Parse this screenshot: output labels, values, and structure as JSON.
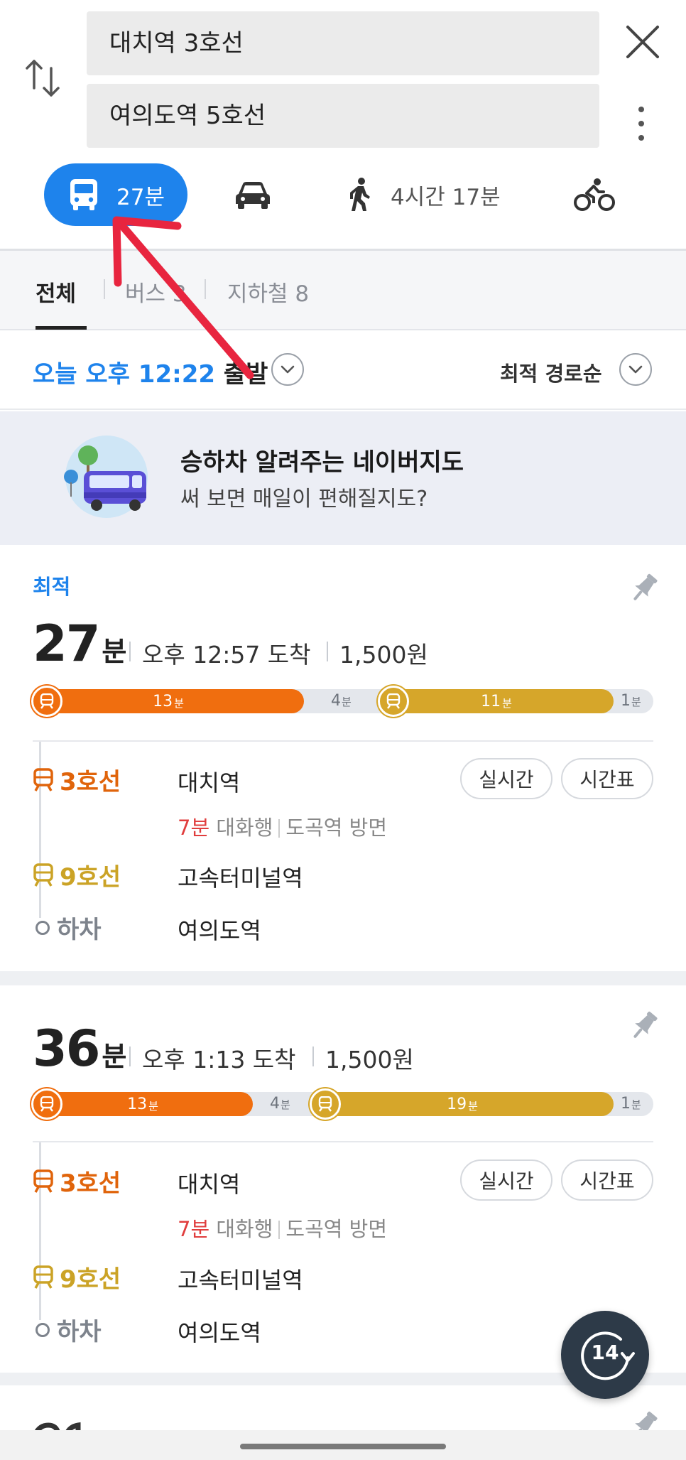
{
  "search": {
    "origin": "대치역 3호선",
    "destination": "여의도역 5호선"
  },
  "modes": {
    "transit": "27분",
    "car": "",
    "walk": "4시간 17분",
    "bike": ""
  },
  "filters": {
    "all": "전체",
    "bus": "버스 3",
    "subway": "지하철 8"
  },
  "departure": {
    "time": "오늘 오후 12:22",
    "suffix": " 출발",
    "sort": "최적 경로순"
  },
  "banner": {
    "title": "승하차 알려주는 네이버지도",
    "subtitle": "써 보면 매일이 편해질지도?"
  },
  "routes": [
    {
      "badge": "최적",
      "duration": "27",
      "duration_unit": "분",
      "arrival": "오후 12:57 도착",
      "fare": "1,500원",
      "segments": [
        {
          "label": "13",
          "unit": "분"
        },
        {
          "label": "4",
          "unit": "分"
        },
        {
          "label": "11",
          "unit": "분"
        },
        {
          "label": "1",
          "unit": "분"
        }
      ],
      "line1": "3호선",
      "station1": "대치역",
      "wait": "7분",
      "direction": "대화행",
      "heading": "도곡역 방면",
      "realtime": "실시간",
      "timetable": "시간표",
      "line2": "9호선",
      "station2": "고속터미널역",
      "alight": "하차",
      "station3": "여의도역"
    },
    {
      "duration": "36",
      "duration_unit": "분",
      "arrival": "오후 1:13 도착",
      "fare": "1,500원",
      "segments": [
        {
          "label": "13",
          "unit": "분"
        },
        {
          "label": "4",
          "unit": "분"
        },
        {
          "label": "19",
          "unit": "분"
        },
        {
          "label": "1",
          "unit": "분"
        }
      ],
      "line1": "3호선",
      "station1": "대치역",
      "wait": "7분",
      "direction": "대화행",
      "heading": "도곡역 방면",
      "realtime": "실시간",
      "timetable": "시간표",
      "line2": "9호선",
      "station2": "고속터미널역",
      "alight": "하차",
      "station3": "여의도역"
    }
  ],
  "fab": {
    "count": "14"
  },
  "colors": {
    "primary": "#1e83ec",
    "line3": "#f06e0f",
    "line9": "#d6a62a",
    "annotation_arrow": "#e8253f"
  }
}
